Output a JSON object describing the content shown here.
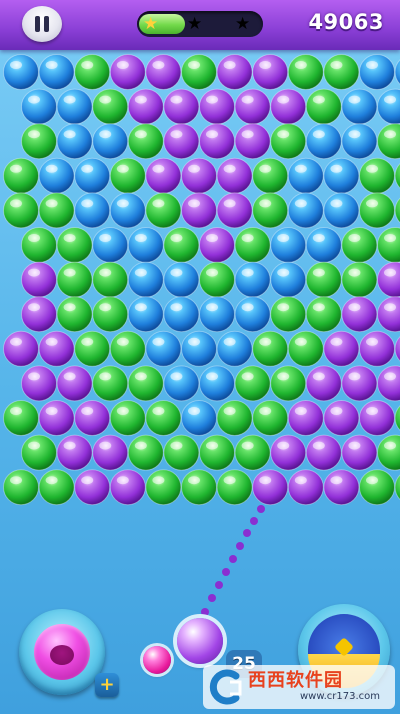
{
  "game": {
    "score": "49063",
    "shots_left": "25",
    "progress_fraction": 0.38,
    "stars_earned": 1,
    "stars_total": 3,
    "current_ball": "purple",
    "next_ball": "magenta",
    "swap_ball_color": "magenta"
  },
  "icons": {
    "pause": "pause-icon",
    "star": "star-icon",
    "plus": "plus-icon",
    "bomb": "bomb-icon"
  },
  "colors": {
    "topbar": "#8a3fd6",
    "background": "#56b5ea",
    "blue": "#2e9bf2",
    "green": "#36cc46",
    "purple": "#a94ee8",
    "star_earned": "#ffd23a"
  },
  "board": {
    "rows": [
      "BBGPPGPPGGBB",
      "BBGPPPPPGBB",
      "GBBGPPPGBBG",
      "GBBGPPPGBBGG",
      "GGBBGPPGBBGG",
      "GGBBGPGBBGG",
      "PGGBBGBBGGP",
      "PGGBBBBGGPP",
      "PPGGBBBGGPPP",
      "PPGGBBGGPPP",
      "GPPGGBGGPPPG",
      "GPPGGGGPPPG",
      "GGPPGGGPPPGG"
    ]
  },
  "watermark": {
    "text": "西西软件园",
    "url": "www.cr173.com"
  }
}
